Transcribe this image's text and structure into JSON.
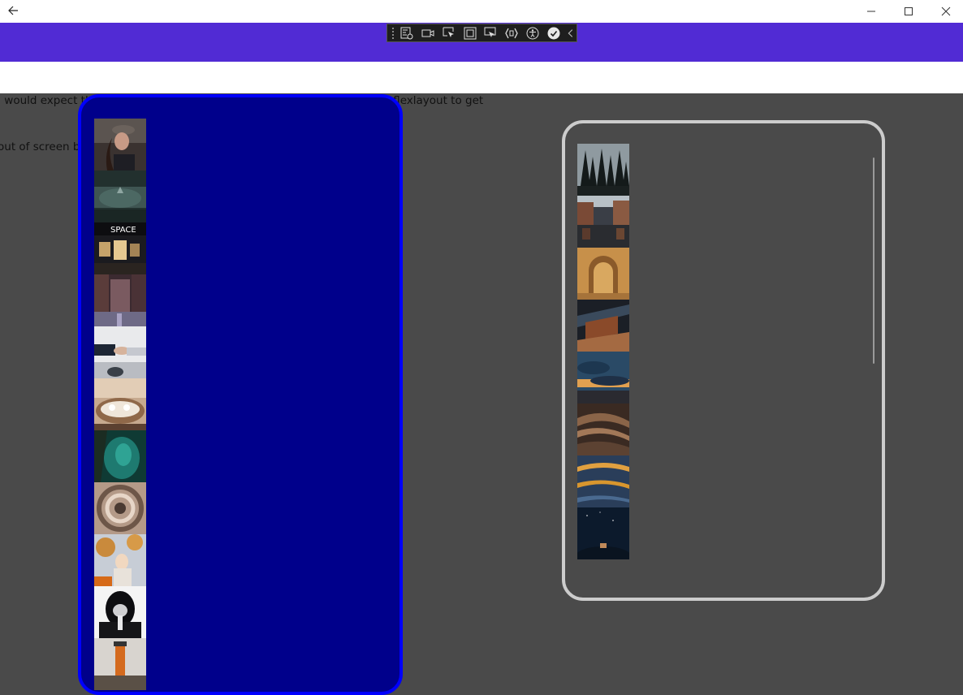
{
  "window": {
    "back_icon": "arrow-left-icon",
    "minimize_icon": "minimize-icon",
    "maximize_icon": "maximize-icon",
    "close_icon": "close-icon"
  },
  "header": {
    "color": "#512bd4"
  },
  "toolbar": {
    "buttons": [
      "live-visual-tree-icon",
      "record-icon",
      "select-element-icon",
      "display-layout-adorners-icon",
      "track-focused-element-icon",
      "hot-reload-icon",
      "accessibility-checker-icon",
      "binding-failures-icon",
      "collapse-toolbar-icon"
    ]
  },
  "message": {
    "line1": "I would expect the left grid with Rowdefenition *,Auto,* not to allow the flexlayout to get",
    "line2": "out of screen bounds and start scrolling"
  },
  "left_panel": {
    "border_color": "#0000ff",
    "background": "#00008b",
    "images": [
      "woman-in-cap-photo",
      "misty-forest-photo",
      "space-sign-night-photo",
      "rainy-street-photo",
      "handshake-photo",
      "dining-table-photo",
      "teal-water-photo",
      "spiral-stairs-photo",
      "autumn-woman-photo",
      "hooded-figure-photo",
      "lighthouse-photo"
    ]
  },
  "right_panel": {
    "border_color": "#cccccc",
    "images": [
      "pine-forest-photo",
      "canal-buildings-photo",
      "stone-arch-photo",
      "abstract-architecture-photo",
      "sunset-clouds-photo",
      "sand-dunes-photo",
      "blue-feather-photo",
      "night-sky-photo"
    ]
  }
}
